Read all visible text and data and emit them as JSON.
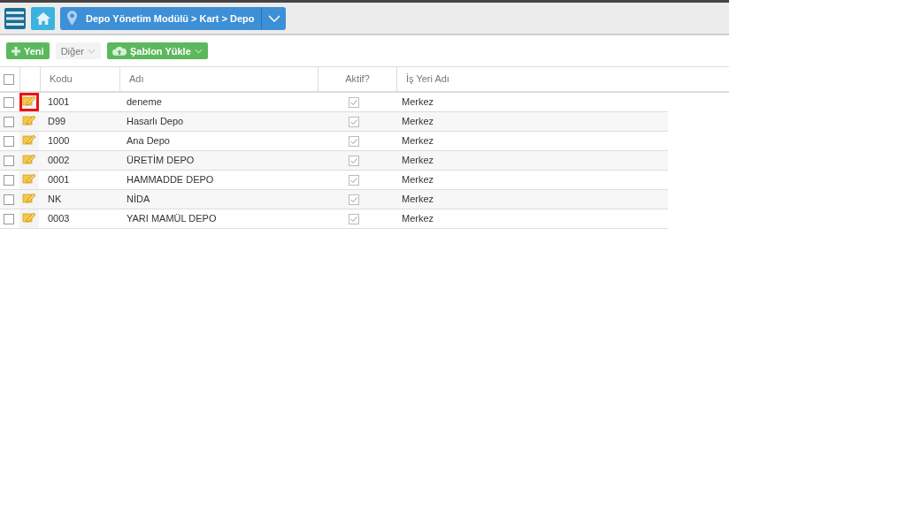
{
  "breadcrumb": "Depo Yönetim Modülü > Kart > Depo",
  "toolbar": {
    "new": "Yeni",
    "other": "Diğer",
    "template": "Şablon Yükle"
  },
  "table": {
    "select_all_checked": false,
    "columns": [
      "Kodu",
      "Adı",
      "Aktif?",
      "İş Yeri Adı"
    ],
    "rows": [
      {
        "checked": false,
        "highlighted": true,
        "code": "1001",
        "name": "deneme",
        "active": true,
        "workplace": "Merkez"
      },
      {
        "checked": false,
        "highlighted": false,
        "code": "D99",
        "name": "Hasarlı Depo",
        "active": true,
        "workplace": "Merkez"
      },
      {
        "checked": false,
        "highlighted": false,
        "code": "1000",
        "name": "Ana Depo",
        "active": true,
        "workplace": "Merkez"
      },
      {
        "checked": false,
        "highlighted": false,
        "code": "0002",
        "name": "ÜRETİM DEPO",
        "active": true,
        "workplace": "Merkez"
      },
      {
        "checked": false,
        "highlighted": false,
        "code": "0001",
        "name": "HAMMADDE DEPO",
        "active": true,
        "workplace": "Merkez"
      },
      {
        "checked": false,
        "highlighted": false,
        "code": "NK",
        "name": "NİDA",
        "active": true,
        "workplace": "Merkez"
      },
      {
        "checked": false,
        "highlighted": false,
        "code": "0003",
        "name": "YARI MAMÜL DEPO",
        "active": true,
        "workplace": "Merkez"
      }
    ]
  }
}
